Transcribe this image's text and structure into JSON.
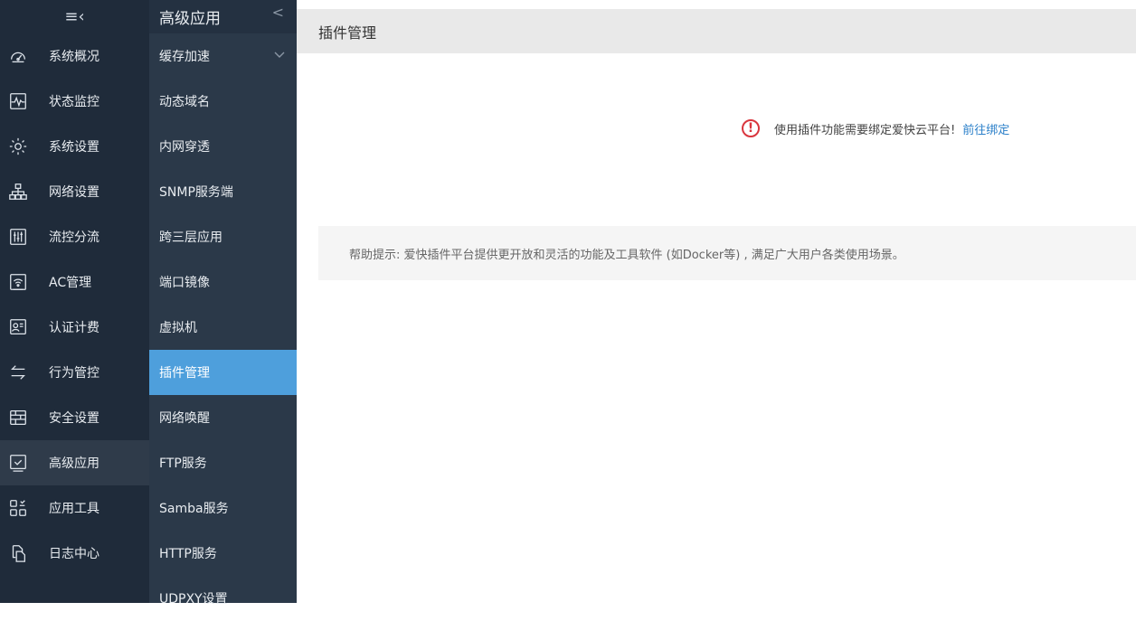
{
  "nav1": {
    "toggle": "≡‹",
    "items": [
      {
        "label": "系统概况",
        "icon": "gauge-icon"
      },
      {
        "label": "状态监控",
        "icon": "pulse-icon"
      },
      {
        "label": "系统设置",
        "icon": "gear-icon"
      },
      {
        "label": "网络设置",
        "icon": "network-icon"
      },
      {
        "label": "流控分流",
        "icon": "sliders-icon"
      },
      {
        "label": "AC管理",
        "icon": "wifi-icon"
      },
      {
        "label": "认证计费",
        "icon": "id-card-icon"
      },
      {
        "label": "行为管控",
        "icon": "swap-arrows-icon"
      },
      {
        "label": "安全设置",
        "icon": "firewall-icon"
      },
      {
        "label": "高级应用",
        "icon": "check-box-icon"
      },
      {
        "label": "应用工具",
        "icon": "apps-icon"
      },
      {
        "label": "日志中心",
        "icon": "document-icon"
      }
    ]
  },
  "nav2": {
    "header": "高级应用",
    "collapse": "<",
    "items": [
      {
        "label": "缓存加速"
      },
      {
        "label": "动态域名"
      },
      {
        "label": "内网穿透"
      },
      {
        "label": "SNMP服务端"
      },
      {
        "label": "跨三层应用"
      },
      {
        "label": "端口镜像"
      },
      {
        "label": "虚拟机"
      },
      {
        "label": "插件管理"
      },
      {
        "label": "网络唤醒"
      },
      {
        "label": "FTP服务"
      },
      {
        "label": "Samba服务"
      },
      {
        "label": "HTTP服务"
      },
      {
        "label": "UDPXY设置"
      }
    ]
  },
  "main": {
    "page_title": "插件管理",
    "notice_text": "使用插件功能需要绑定爱快云平台!",
    "notice_link": "前往绑定",
    "warn_glyph": "!",
    "help_text": "帮助提示: 爱快插件平台提供更开放和灵活的功能及工具软件 (如Docker等) , 满足广大用户各类使用场景。"
  },
  "colors": {
    "nav1_bg": "#1f2b3a",
    "nav2_bg": "#2b3949",
    "selected": "#4e9fdc",
    "link": "#2a7fc9",
    "warning": "#d9363e"
  }
}
